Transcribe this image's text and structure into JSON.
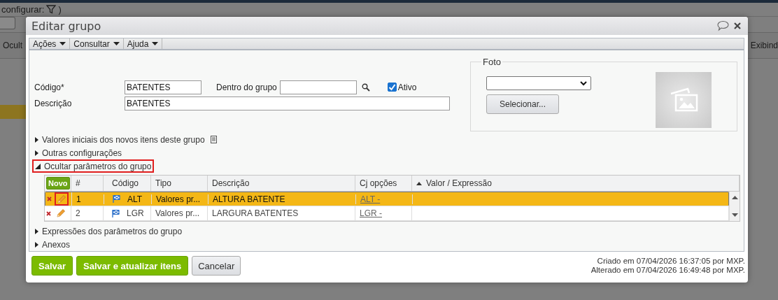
{
  "background": {
    "filter_label": "configurar:",
    "paren": ")",
    "left_text": "Ocult",
    "right_text": "Exibind"
  },
  "dialog": {
    "title": "Editar grupo",
    "menu": [
      {
        "label": "Ações"
      },
      {
        "label": "Consultar"
      },
      {
        "label": "Ajuda"
      }
    ],
    "form": {
      "code_label": "Código*",
      "code_value": "BATENTES",
      "parent_label": "Dentro do grupo",
      "active_label": "Ativo",
      "active_checked": true,
      "description_label": "Descrição",
      "description_value": "BATENTES"
    },
    "photo": {
      "legend": "Foto",
      "select_button": "Selecionar..."
    },
    "sections_top": [
      {
        "label": "Valores iniciais dos novos itens deste grupo",
        "expanded": false,
        "highlighted": false,
        "has_note_icon": true
      },
      {
        "label": "Outras configurações",
        "expanded": false,
        "highlighted": false,
        "has_note_icon": false
      },
      {
        "label": "Ocultar parâmetros do grupo",
        "expanded": true,
        "highlighted": true,
        "has_note_icon": false
      }
    ],
    "table": {
      "new_button": "Novo",
      "columns": [
        "#",
        "Código",
        "Tipo",
        "Descrição",
        "Cj opções",
        "Valor / Expressão"
      ],
      "rows": [
        {
          "selected": true,
          "edit_highlighted": true,
          "number": "1",
          "code": "ALT",
          "type": "Valores pr...",
          "description": "ALTURA BATENTE",
          "option_set": "ALT -"
        },
        {
          "selected": false,
          "edit_highlighted": false,
          "number": "2",
          "code": "LGR",
          "type": "Valores pr...",
          "description": "LARGURA BATENTES",
          "option_set": "LGR -"
        }
      ]
    },
    "sections_bottom": [
      {
        "label": "Expressões dos parâmetros do grupo",
        "expanded": false,
        "highlighted": false,
        "has_note_icon": false
      },
      {
        "label": "Anexos",
        "expanded": false,
        "highlighted": false,
        "has_note_icon": false
      }
    ],
    "buttons": [
      {
        "label": "Salvar",
        "kind": "primary"
      },
      {
        "label": "Salvar e atualizar itens",
        "kind": "primary"
      },
      {
        "label": "Cancelar",
        "kind": "secondary"
      }
    ],
    "audit": [
      "Criado em 07/04/2026 16:37:05 por MXP.",
      "Alterado em 07/04/2026 16:49:48 por MXP."
    ]
  }
}
